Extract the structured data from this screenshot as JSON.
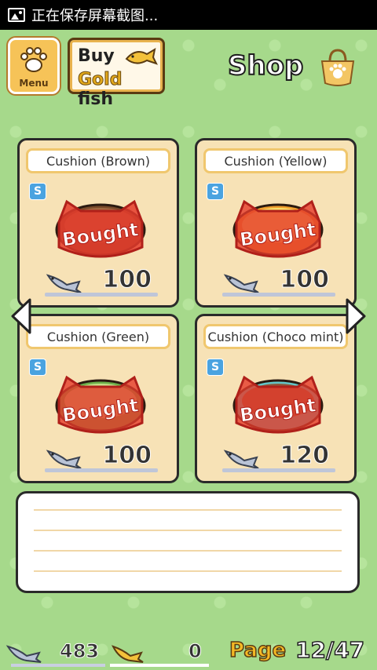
{
  "status_bar": {
    "text": "正在保存屏幕截图..."
  },
  "header": {
    "menu_label": "Menu",
    "goldfish_button": {
      "line1": "Buy",
      "gold": "Gold",
      "fish": "fish"
    },
    "title": "Shop"
  },
  "items": [
    {
      "name": "Cushion (Brown)",
      "price": "100",
      "status": "Bought",
      "badge": "S",
      "color": "#8a5a3a"
    },
    {
      "name": "Cushion (Yellow)",
      "price": "100",
      "status": "Bought",
      "badge": "S",
      "color": "#f4d25a"
    },
    {
      "name": "Cushion (Green)",
      "price": "100",
      "status": "Bought",
      "badge": "S",
      "color": "#a9d36e"
    },
    {
      "name": "Cushion (Choco mint)",
      "price": "120",
      "status": "Bought",
      "badge": "S",
      "color": "#8b5a3c"
    }
  ],
  "currency": {
    "silver_fish": "483",
    "gold_fish": "0"
  },
  "pagination": {
    "label": "Page",
    "value": "12/47"
  },
  "colors": {
    "background": "#a6d98b",
    "card": "#f7e2b6",
    "bought_stamp": "#e53b2b",
    "accent_gold": "#f4b824"
  }
}
